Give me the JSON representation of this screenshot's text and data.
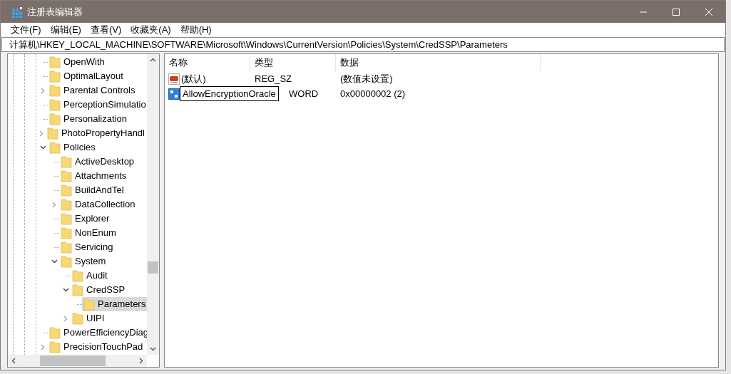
{
  "window": {
    "title": "注册表编辑器"
  },
  "menu": [
    "文件(F)",
    "编辑(E)",
    "查看(V)",
    "收藏夹(A)",
    "帮助(H)"
  ],
  "address": "计算机\\HKEY_LOCAL_MACHINE\\SOFTWARE\\Microsoft\\Windows\\CurrentVersion\\Policies\\System\\CredSSP\\Parameters",
  "tree": [
    {
      "name": "OpenWith",
      "has_children": false,
      "selected": false
    },
    {
      "name": "OptimalLayout",
      "has_children": false,
      "selected": false
    },
    {
      "name": "Parental Controls",
      "has_children": true,
      "expanded": false,
      "selected": false
    },
    {
      "name": "PerceptionSimulatio",
      "has_children": false,
      "selected": false
    },
    {
      "name": "Personalization",
      "has_children": false,
      "selected": false
    },
    {
      "name": "PhotoPropertyHandl",
      "has_children": true,
      "expanded": false,
      "selected": false
    },
    {
      "name": "Policies",
      "has_children": true,
      "expanded": true,
      "selected": false,
      "children": [
        {
          "name": "ActiveDesktop",
          "has_children": false,
          "selected": false
        },
        {
          "name": "Attachments",
          "has_children": false,
          "selected": false
        },
        {
          "name": "BuildAndTel",
          "has_children": false,
          "selected": false
        },
        {
          "name": "DataCollection",
          "has_children": true,
          "expanded": false,
          "selected": false
        },
        {
          "name": "Explorer",
          "has_children": false,
          "selected": false
        },
        {
          "name": "NonEnum",
          "has_children": false,
          "selected": false
        },
        {
          "name": "Servicing",
          "has_children": false,
          "selected": false
        },
        {
          "name": "System",
          "has_children": true,
          "expanded": true,
          "selected": false,
          "children": [
            {
              "name": "Audit",
              "has_children": false,
              "selected": false
            },
            {
              "name": "CredSSP",
              "has_children": true,
              "expanded": true,
              "selected": false,
              "children": [
                {
                  "name": "Parameters",
                  "has_children": false,
                  "selected": true
                }
              ]
            },
            {
              "name": "UIPI",
              "has_children": true,
              "expanded": false,
              "selected": false
            }
          ]
        }
      ]
    },
    {
      "name": "PowerEfficiencyDiag",
      "has_children": false,
      "selected": false
    },
    {
      "name": "PrecisionTouchPad",
      "has_children": true,
      "expanded": false,
      "selected": false
    }
  ],
  "table": {
    "columns": [
      "名称",
      "类型",
      "数据"
    ],
    "rows": [
      {
        "kind": "string",
        "name": "(默认)",
        "type": "REG_SZ",
        "data": "(数值未设置)",
        "renaming": false
      },
      {
        "kind": "binary",
        "name": "AllowEncryptionOracle",
        "type": "WORD",
        "data": "0x00000002 (2)",
        "renaming": true
      }
    ]
  }
}
